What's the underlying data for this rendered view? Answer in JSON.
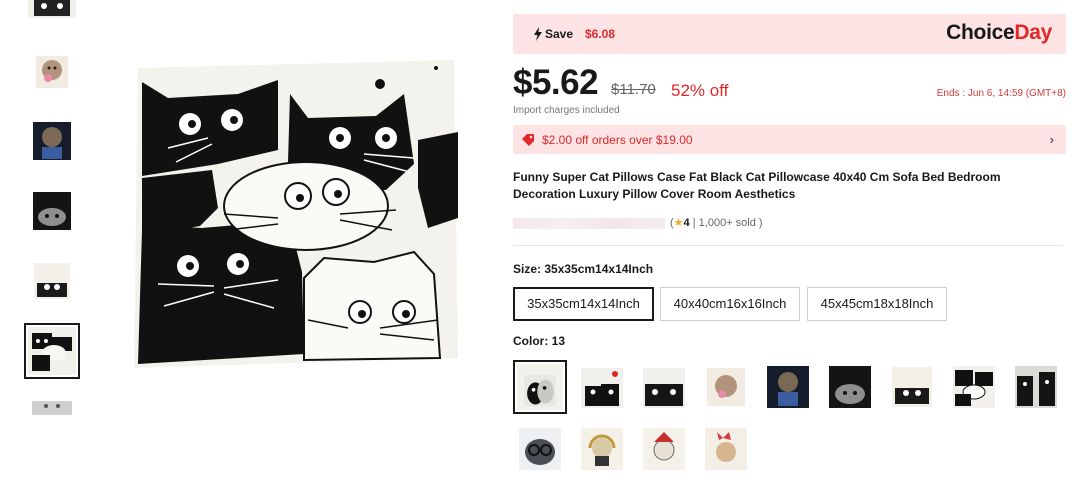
{
  "gallery": {
    "thumbnails": [
      {
        "name": "thumb-1",
        "variant": "black-cats-bottom-strip"
      },
      {
        "name": "thumb-2",
        "variant": "pink-cat-portrait"
      },
      {
        "name": "thumb-3",
        "variant": "dark-blue-cat"
      },
      {
        "name": "thumb-4",
        "variant": "black-tabby-cat"
      },
      {
        "name": "thumb-5",
        "variant": "cat-peeking-window"
      },
      {
        "name": "thumb-6",
        "variant": "black-white-cat-group",
        "selected": true
      },
      {
        "name": "thumb-7",
        "variant": "grey-pillow-top"
      }
    ],
    "main_image": "black-white-cat-group"
  },
  "banner": {
    "save_label": "Save",
    "save_amount": "$6.08",
    "brand_part1": "Choice",
    "brand_part2": "Day",
    "accent_color": "#e0282a",
    "background_color": "#fde3e3"
  },
  "pricing": {
    "price": "$5.62",
    "original_price": "$11.70",
    "discount": "52% off",
    "ends": "Ends :  Jun 6, 14:59 (GMT+8)",
    "import_note": "Import charges included"
  },
  "coupon": {
    "text": "$2.00 off orders over $19.00",
    "chevron": "›"
  },
  "product": {
    "title": "Funny Super Cat Pillows Case Fat Black Cat Pillowcase 40x40 Cm Sofa Bed Bedroom Decoration Luxury Pillow Cover Room Aesthetics",
    "rating_open": "(",
    "rating_star": "★",
    "rating_value": "4",
    "rating_sep": " | ",
    "sold": "1,000+ sold",
    "rating_close": " )"
  },
  "size": {
    "label": "Size: 35x35cm14x14Inch",
    "options": [
      "35x35cm14x14Inch",
      "40x40cm16x16Inch",
      "45x45cm18x18Inch"
    ],
    "selected_index": 0
  },
  "color": {
    "label": "Color: 13",
    "swatches": [
      {
        "name": "swatch-13",
        "variant": "black-white-cat-group",
        "selected": true
      },
      {
        "name": "swatch-1",
        "variant": "black-white-cat-red-heart"
      },
      {
        "name": "swatch-2",
        "variant": "black-cats-bottom-strip"
      },
      {
        "name": "swatch-3",
        "variant": "pink-cat-portrait"
      },
      {
        "name": "swatch-4",
        "variant": "dark-blue-cat"
      },
      {
        "name": "swatch-5",
        "variant": "black-tabby-cat"
      },
      {
        "name": "swatch-6",
        "variant": "cat-peeking-window"
      },
      {
        "name": "swatch-7",
        "variant": "black-white-cat-group-2"
      },
      {
        "name": "swatch-8",
        "variant": "black-cats-grey"
      },
      {
        "name": "swatch-9",
        "variant": "grey-cat-glasses"
      },
      {
        "name": "swatch-10",
        "variant": "cat-headphones"
      },
      {
        "name": "swatch-11",
        "variant": "cat-red-hat"
      },
      {
        "name": "swatch-12",
        "variant": "cat-red-bow"
      }
    ]
  }
}
